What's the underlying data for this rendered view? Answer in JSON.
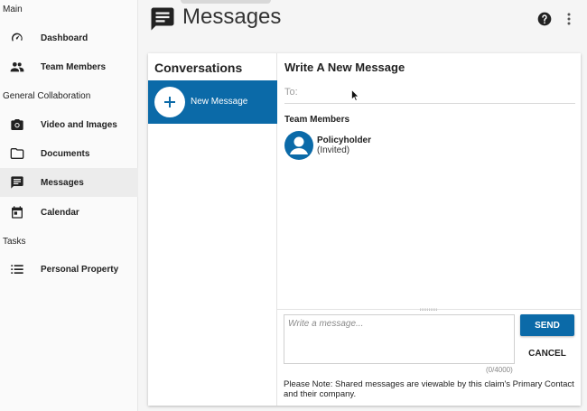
{
  "sidebar": {
    "sections": {
      "main": "Main",
      "collab": "General Collaboration",
      "tasks": "Tasks"
    },
    "items": [
      {
        "label": "Dashboard",
        "icon": "speedometer-icon"
      },
      {
        "label": "Team Members",
        "icon": "people-icon"
      },
      {
        "label": "Video and Images",
        "icon": "camera-icon"
      },
      {
        "label": "Documents",
        "icon": "folder-icon"
      },
      {
        "label": "Messages",
        "icon": "message-icon",
        "active": true
      },
      {
        "label": "Calendar",
        "icon": "calendar-icon"
      },
      {
        "label": "Personal Property",
        "icon": "list-icon"
      }
    ]
  },
  "header": {
    "title": "Messages",
    "icon": "message-icon"
  },
  "conversations": {
    "title": "Conversations",
    "new_message_label": "New Message"
  },
  "compose": {
    "title": "Write A New Message",
    "to_placeholder": "To:",
    "members_label": "Team Members",
    "members": [
      {
        "name": "Policyholder",
        "status": "(Invited)"
      }
    ],
    "message_placeholder": "Write a message...",
    "counter": "(0/4000)",
    "send_label": "SEND",
    "cancel_label": "CANCEL",
    "note": "Please Note: Shared messages are viewable by this claim's Primary Contact and their company."
  },
  "colors": {
    "accent": "#0b6aa8"
  }
}
